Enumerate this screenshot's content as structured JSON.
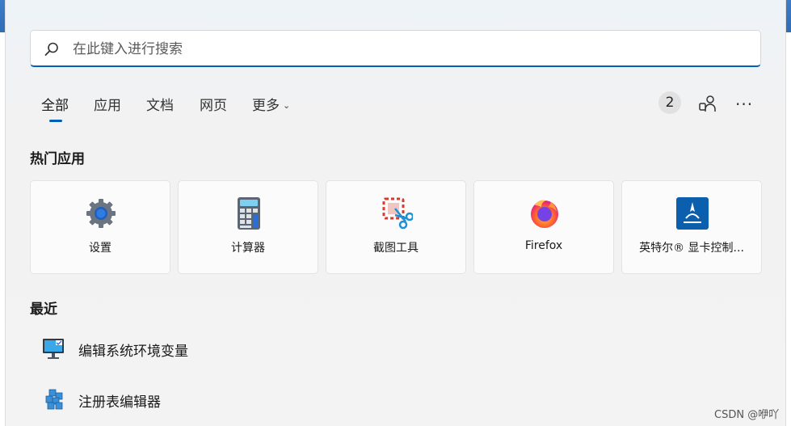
{
  "search": {
    "placeholder": "在此键入进行搜索"
  },
  "tabs": [
    {
      "label": "全部"
    },
    {
      "label": "应用"
    },
    {
      "label": "文档"
    },
    {
      "label": "网页"
    },
    {
      "label": "更多"
    }
  ],
  "header": {
    "badge_count": "2"
  },
  "top_apps": {
    "title": "热门应用",
    "items": [
      {
        "label": "设置",
        "icon": "gear-icon"
      },
      {
        "label": "计算器",
        "icon": "calculator-icon"
      },
      {
        "label": "截图工具",
        "icon": "snipping-tool-icon"
      },
      {
        "label": "Firefox",
        "icon": "firefox-icon"
      },
      {
        "label": "英特尔® 显卡控制...",
        "icon": "intel-graphics-icon"
      }
    ]
  },
  "recent": {
    "title": "最近",
    "items": [
      {
        "label": "编辑系统环境变量",
        "icon": "system-properties-icon"
      },
      {
        "label": "注册表编辑器",
        "icon": "regedit-icon"
      }
    ]
  },
  "watermark": "CSDN @咿吖",
  "colors": {
    "accent": "#005fb8",
    "panel": "#f3f3f3"
  }
}
